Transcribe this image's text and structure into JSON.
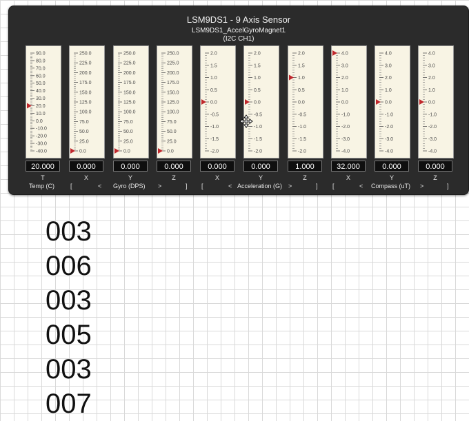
{
  "panel": {
    "title": "LSM9DS1 - 9 Axis Sensor",
    "subtitle": "LSM9DS1_AccelGyroMagnet1",
    "bus": "(I2C CH1)"
  },
  "gauges": [
    {
      "axis": "T",
      "value": "20.000",
      "min": -40,
      "max": 90,
      "labels": [
        "90.0",
        "80.0",
        "70.0",
        "60.0",
        "50.0",
        "40.0",
        "30.0",
        "20.0",
        "10.0",
        "0.0",
        "-10.0",
        "-20.0",
        "-30.0",
        "-40.0"
      ],
      "marker": 20
    },
    {
      "axis": "X",
      "value": "0.000",
      "min": 0,
      "max": 250,
      "labels": [
        "250.0",
        "225.0",
        "200.0",
        "175.0",
        "150.0",
        "125.0",
        "100.0",
        "75.0",
        "50.0",
        "25.0",
        "0.0"
      ],
      "marker": 0
    },
    {
      "axis": "Y",
      "value": "0.000",
      "min": 0,
      "max": 250,
      "labels": [
        "250.0",
        "225.0",
        "200.0",
        "175.0",
        "150.0",
        "125.0",
        "100.0",
        "75.0",
        "50.0",
        "25.0",
        "0.0"
      ],
      "marker": 0
    },
    {
      "axis": "Z",
      "value": "0.000",
      "min": 0,
      "max": 250,
      "labels": [
        "250.0",
        "225.0",
        "200.0",
        "175.0",
        "150.0",
        "125.0",
        "100.0",
        "75.0",
        "50.0",
        "25.0",
        "0.0"
      ],
      "marker": 0
    },
    {
      "axis": "X",
      "value": "0.000",
      "min": -2,
      "max": 2,
      "labels": [
        "2.0",
        "1.5",
        "1.0",
        "0.5",
        "0.0",
        "-0.5",
        "-1.0",
        "-1.5",
        "-2.0"
      ],
      "marker": 0
    },
    {
      "axis": "Y",
      "value": "0.000",
      "min": -2,
      "max": 2,
      "labels": [
        "2.0",
        "1.5",
        "1.0",
        "0.5",
        "0.0",
        "-0.5",
        "-1.0",
        "-1.5",
        "-2.0"
      ],
      "marker": 0
    },
    {
      "axis": "Z",
      "value": "1.000",
      "min": -2,
      "max": 2,
      "labels": [
        "2.0",
        "1.5",
        "1.0",
        "0.5",
        "0.0",
        "-0.5",
        "-1.0",
        "-1.5",
        "-2.0"
      ],
      "marker": 1
    },
    {
      "axis": "X",
      "value": "32.000",
      "min": -4,
      "max": 4,
      "labels": [
        "4.0",
        "3.0",
        "2.0",
        "1.0",
        "0.0",
        "-1.0",
        "-2.0",
        "-3.0",
        "-4.0"
      ],
      "marker": 4
    },
    {
      "axis": "Y",
      "value": "0.000",
      "min": -4,
      "max": 4,
      "labels": [
        "4.0",
        "3.0",
        "2.0",
        "1.0",
        "0.0",
        "-1.0",
        "-2.0",
        "-3.0",
        "-4.0"
      ],
      "marker": 0
    },
    {
      "axis": "Z",
      "value": "0.000",
      "min": -4,
      "max": 4,
      "labels": [
        "4.0",
        "3.0",
        "2.0",
        "1.0",
        "0.0",
        "-1.0",
        "-2.0",
        "-3.0",
        "-4.0"
      ],
      "marker": 0
    }
  ],
  "groups": {
    "temp": "Temp (C)",
    "gyro": {
      "open": "[",
      "lt": "<",
      "label": "Gyro (DPS)",
      "gt": ">",
      "close": "]"
    },
    "accel": {
      "open": "[",
      "lt": "<",
      "label": "Acceleration (G)",
      "gt": ">",
      "close": "]"
    },
    "compass": {
      "open": "[",
      "lt": "<",
      "label": "Compass (uT)",
      "gt": ">",
      "close": "]"
    }
  },
  "numbers": [
    "003",
    "006",
    "003",
    "005",
    "003",
    "007"
  ],
  "colors": {
    "panel": "#2b2b2b",
    "gauge_face": "#f8f4e4",
    "marker": "#c0282d"
  }
}
